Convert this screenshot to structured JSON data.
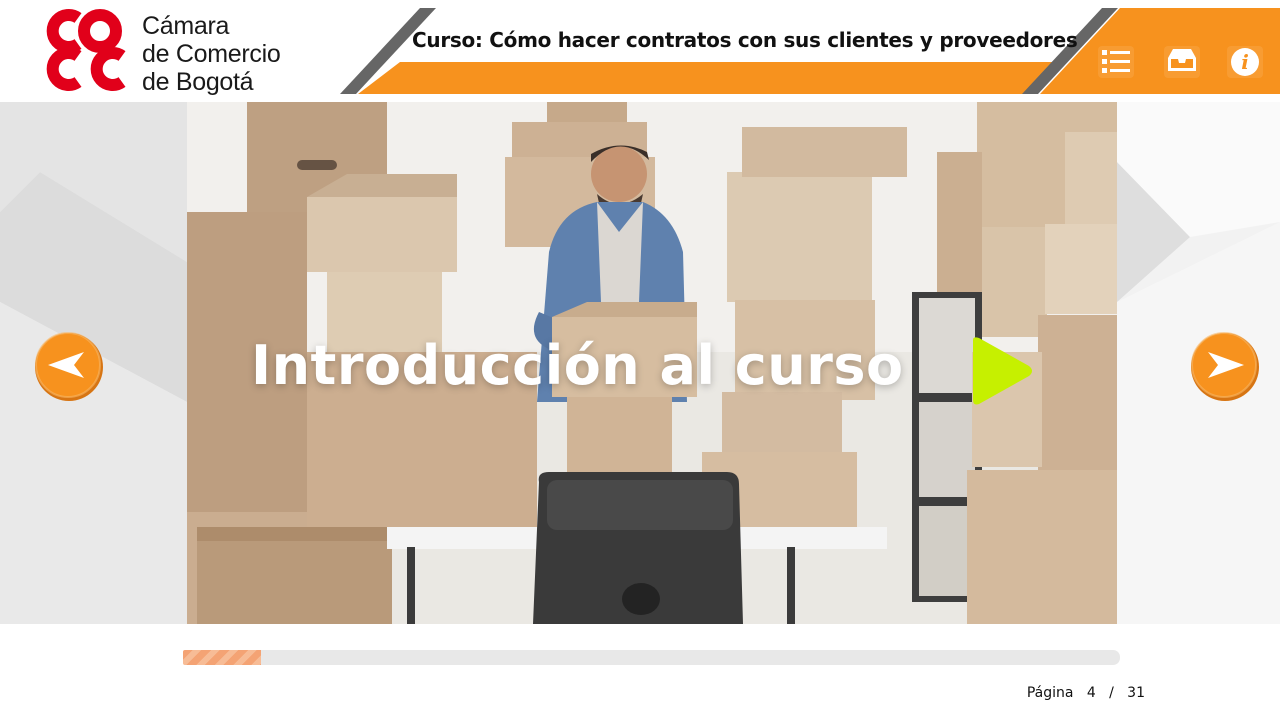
{
  "brand": {
    "line1": "Cámara",
    "line2": "de Comercio",
    "line3": "de Bogotá",
    "logo_color": "#e1001a"
  },
  "header": {
    "course_title": "Curso: Cómo hacer contratos con sus clientes y proveedores",
    "accent_color": "#f7921e",
    "icons": [
      "menu-list-icon",
      "inbox-tray-icon",
      "info-icon"
    ]
  },
  "slide": {
    "title": "Introducción al curso",
    "play_color": "#c6f000"
  },
  "navigation": {
    "prev_icon": "arrow-left-icon",
    "next_icon": "arrow-right-icon",
    "button_color": "#f7921e"
  },
  "progress": {
    "current_page": 4,
    "total_pages": 31,
    "page_label": "Página",
    "separator": "/",
    "fraction": 0.083
  }
}
